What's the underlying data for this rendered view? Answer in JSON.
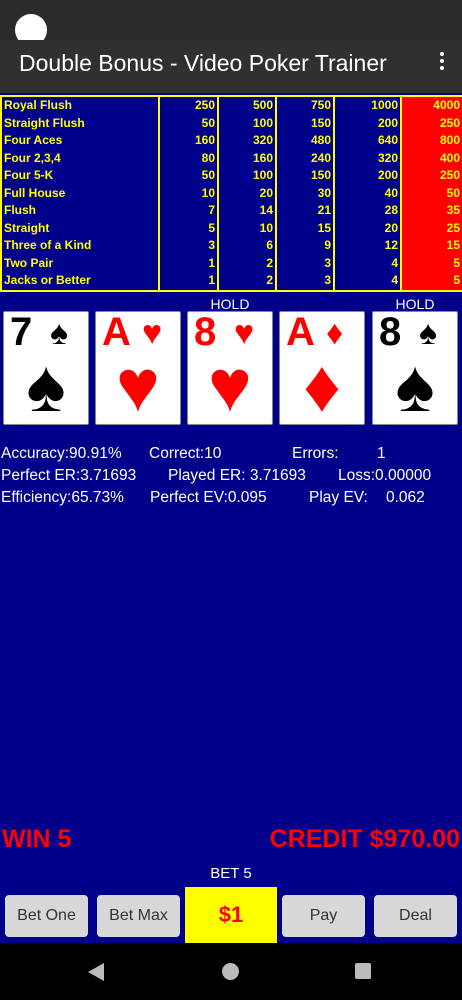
{
  "app": {
    "title": "Double Bonus - Video Poker Trainer",
    "menu_icon": "more-vert-icon"
  },
  "paytable": {
    "hands": [
      "Royal Flush",
      "Straight Flush",
      "Four Aces",
      "Four 2,3,4",
      "Four 5-K",
      "Full House",
      "Flush",
      "Straight",
      "Three of a Kind",
      "Two Pair",
      "Jacks or Better"
    ],
    "col1": [
      "250",
      "50",
      "160",
      "80",
      "50",
      "10",
      "7",
      "5",
      "3",
      "1",
      "1"
    ],
    "col2": [
      "500",
      "100",
      "320",
      "160",
      "100",
      "20",
      "14",
      "10",
      "6",
      "2",
      "2"
    ],
    "col3": [
      "750",
      "150",
      "480",
      "240",
      "150",
      "30",
      "21",
      "15",
      "9",
      "3",
      "3"
    ],
    "col4": [
      "1000",
      "200",
      "640",
      "320",
      "200",
      "40",
      "28",
      "20",
      "12",
      "4",
      "4"
    ],
    "col5": [
      "4000",
      "250",
      "800",
      "400",
      "250",
      "50",
      "35",
      "25",
      "15",
      "5",
      "5"
    ],
    "highlight_color": "#ff0000",
    "text_color": "#ffff00"
  },
  "cards": [
    {
      "rank": "7",
      "suit": "♠",
      "color": "black",
      "hold": ""
    },
    {
      "rank": "A",
      "suit": "♥",
      "color": "red",
      "hold": ""
    },
    {
      "rank": "8",
      "suit": "♥",
      "color": "red",
      "hold": "HOLD"
    },
    {
      "rank": "A",
      "suit": "♦",
      "color": "red",
      "hold": ""
    },
    {
      "rank": "8",
      "suit": "♠",
      "color": "black",
      "hold": "HOLD"
    }
  ],
  "stats": {
    "accuracy": "Accuracy:90.91%",
    "correct": "Correct:10",
    "errors_label": "Errors:",
    "errors_value": "1",
    "perfect_er": "Perfect ER:3.71693",
    "played_er": "Played ER:  3.71693",
    "loss": "Loss:0.00000",
    "efficiency": "Efficiency:65.73%",
    "perfect_ev": "Perfect EV:0.095",
    "play_ev_label": "Play EV:",
    "play_ev_value": "0.062"
  },
  "win": "WIN 5",
  "credit": "CREDIT $970.00",
  "bet": "BET 5",
  "buttons": {
    "bet_one": "Bet One",
    "bet_max": "Bet Max",
    "denom": "$1",
    "pay": "Pay",
    "deal": "Deal"
  },
  "colors": {
    "background": "#00008b",
    "accent": "#ffff00",
    "alert": "#ff0000"
  }
}
